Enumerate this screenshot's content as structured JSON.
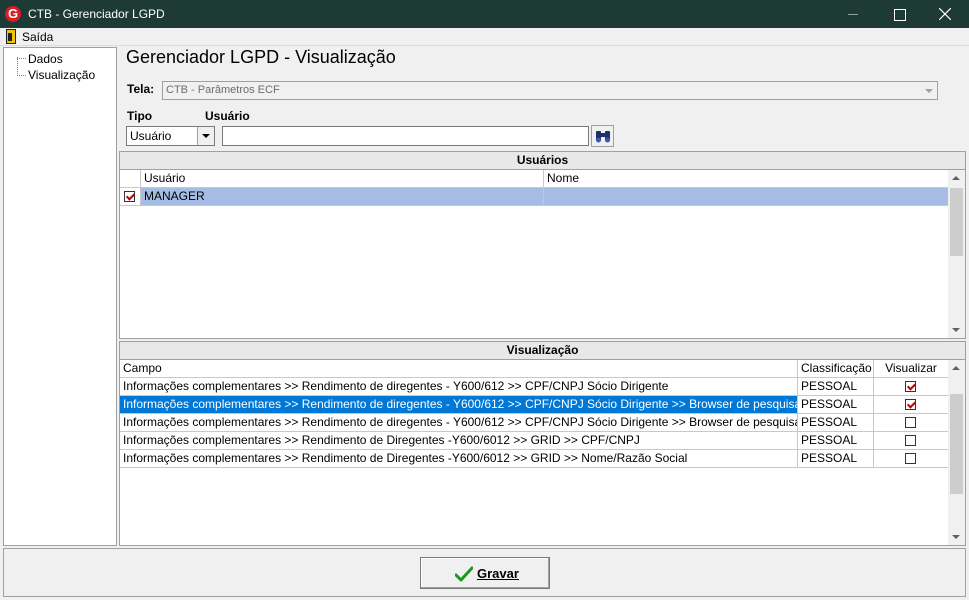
{
  "window": {
    "title": "CTB - Gerenciador LGPD",
    "app_icon": "G"
  },
  "menu": {
    "exit_label": "Saída"
  },
  "tree": {
    "items": [
      "Dados",
      "Visualização"
    ]
  },
  "page": {
    "title": "Gerenciador LGPD - Visualização"
  },
  "form": {
    "tela_label": "Tela:",
    "tela_value": "CTB - Parâmetros ECF",
    "tipo_label": "Tipo",
    "tipo_value": "Usuário",
    "usuario_label": "Usuário",
    "usuario_value": ""
  },
  "users_panel": {
    "title": "Usuários",
    "columns": [
      "Usuário",
      "Nome"
    ],
    "rows": [
      {
        "checked": true,
        "usuario": "MANAGER",
        "nome": ""
      }
    ]
  },
  "visualization_panel": {
    "title": "Visualização",
    "columns": [
      "Campo",
      "Classificação",
      "Visualizar"
    ],
    "rows": [
      {
        "campo": "Informações complementares >> Rendimento de diregentes - Y600/612 >> CPF/CNPJ Sócio Dirigente",
        "classificacao": "PESSOAL",
        "visualizar": true
      },
      {
        "campo": "Informações complementares >> Rendimento de diregentes - Y600/612 >> CPF/CNPJ Sócio Dirigente >> Browser de pesquisa >> CPF/CNPJ",
        "classificacao": "PESSOAL",
        "visualizar": true
      },
      {
        "campo": "Informações complementares >> Rendimento de diregentes - Y600/612 >> CPF/CNPJ Sócio Dirigente >> Browser de pesquisa >> Nome/Ra...",
        "classificacao": "PESSOAL",
        "visualizar": false
      },
      {
        "campo": "Informações complementares >> Rendimento de Diregentes -Y600/6012 >> GRID >> CPF/CNPJ",
        "classificacao": "PESSOAL",
        "visualizar": false
      },
      {
        "campo": "Informações complementares >> Rendimento de Diregentes -Y600/6012 >> GRID >> Nome/Razão Social",
        "classificacao": "PESSOAL",
        "visualizar": false
      }
    ]
  },
  "footer": {
    "save_label": "Gravar"
  },
  "colors": {
    "titlebar": "#1d3a34",
    "selection": "#0078d7",
    "selection_light": "#a5bde5",
    "check_mark": "#c00000",
    "save_check": "#1a9a1a"
  }
}
